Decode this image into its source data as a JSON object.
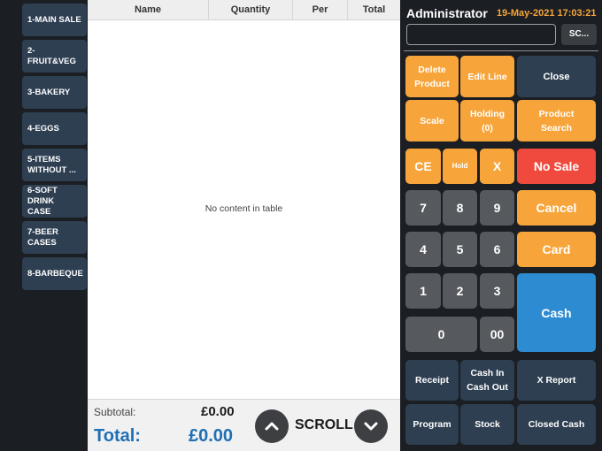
{
  "categories": [
    "1-MAIN SALE",
    "2-FRUIT&VEG",
    "3-BAKERY",
    "4-EGGS",
    "5-ITEMS\nWITHOUT ...",
    "6-SOFT DRINK\nCASE",
    "7-BEER CASES",
    "8-BARBEQUE"
  ],
  "table": {
    "columns": [
      "Name",
      "Quantity",
      "Per",
      "Total"
    ],
    "empty_message": "No content in table"
  },
  "footer": {
    "subtotal_label": "Subtotal:",
    "subtotal_value": "£0.00",
    "total_label": "Total:",
    "total_value": "£0.00",
    "scroll_label": "SCROLL"
  },
  "header": {
    "user": "Administrator",
    "datetime": "19-May-2021 17:03:21",
    "barcode_placeholder": "",
    "sc_label": "SC..."
  },
  "actions": {
    "delete_product": "Delete\nProduct",
    "edit_line": "Edit Line",
    "close": "Close",
    "scale": "Scale",
    "holding": "Holding\n(0)",
    "product_search": "Product\nSearch",
    "ce": "CE",
    "hold": "Hold",
    "x": "X",
    "no_sale": "No Sale",
    "cancel": "Cancel",
    "card": "Card",
    "cash": "Cash",
    "receipt": "Receipt",
    "cash_in_out": "Cash In\nCash Out",
    "x_report": "X Report",
    "program": "Program",
    "stock": "Stock",
    "closed_cash": "Closed Cash"
  },
  "keypad": {
    "k7": "7",
    "k8": "8",
    "k9": "9",
    "k4": "4",
    "k5": "5",
    "k6": "6",
    "k1": "1",
    "k2": "2",
    "k3": "3",
    "k0": "0",
    "k00": "00"
  },
  "colors": {
    "accent_orange": "#f7a53a",
    "navy": "#2e3f52",
    "red": "#f04a3e",
    "blue": "#2d8bd2",
    "total_blue": "#1f6fb5"
  },
  "icons": {
    "scroll_up": "chevron-up-icon",
    "scroll_down": "chevron-down-icon"
  }
}
